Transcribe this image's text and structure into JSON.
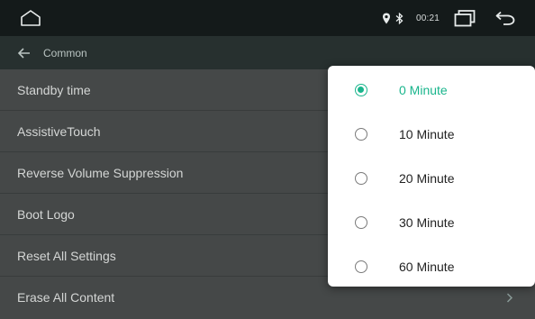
{
  "status_bar": {
    "time": "00:21",
    "icons": [
      "home-icon",
      "location-pin-icon",
      "bluetooth-icon",
      "recent-apps-icon",
      "back-icon"
    ]
  },
  "header": {
    "title": "Common",
    "back_icon": "arrow-left-icon"
  },
  "settings": {
    "items": [
      {
        "label": "Standby time"
      },
      {
        "label": "AssistiveTouch"
      },
      {
        "label": "Reverse Volume Suppression"
      },
      {
        "label": "Boot Logo"
      },
      {
        "label": "Reset All Settings"
      },
      {
        "label": "Erase All Content"
      }
    ]
  },
  "standby_popup": {
    "selected_index": 0,
    "options": [
      {
        "label": "0 Minute"
      },
      {
        "label": "10 Minute"
      },
      {
        "label": "20 Minute"
      },
      {
        "label": "30 Minute"
      },
      {
        "label": "60 Minute"
      }
    ]
  },
  "colors": {
    "accent": "#19b58c",
    "status_bar_bg": "#141a1a",
    "title_bar_bg": "#27302f",
    "list_bg": "#454848",
    "popup_bg": "#ffffff"
  }
}
